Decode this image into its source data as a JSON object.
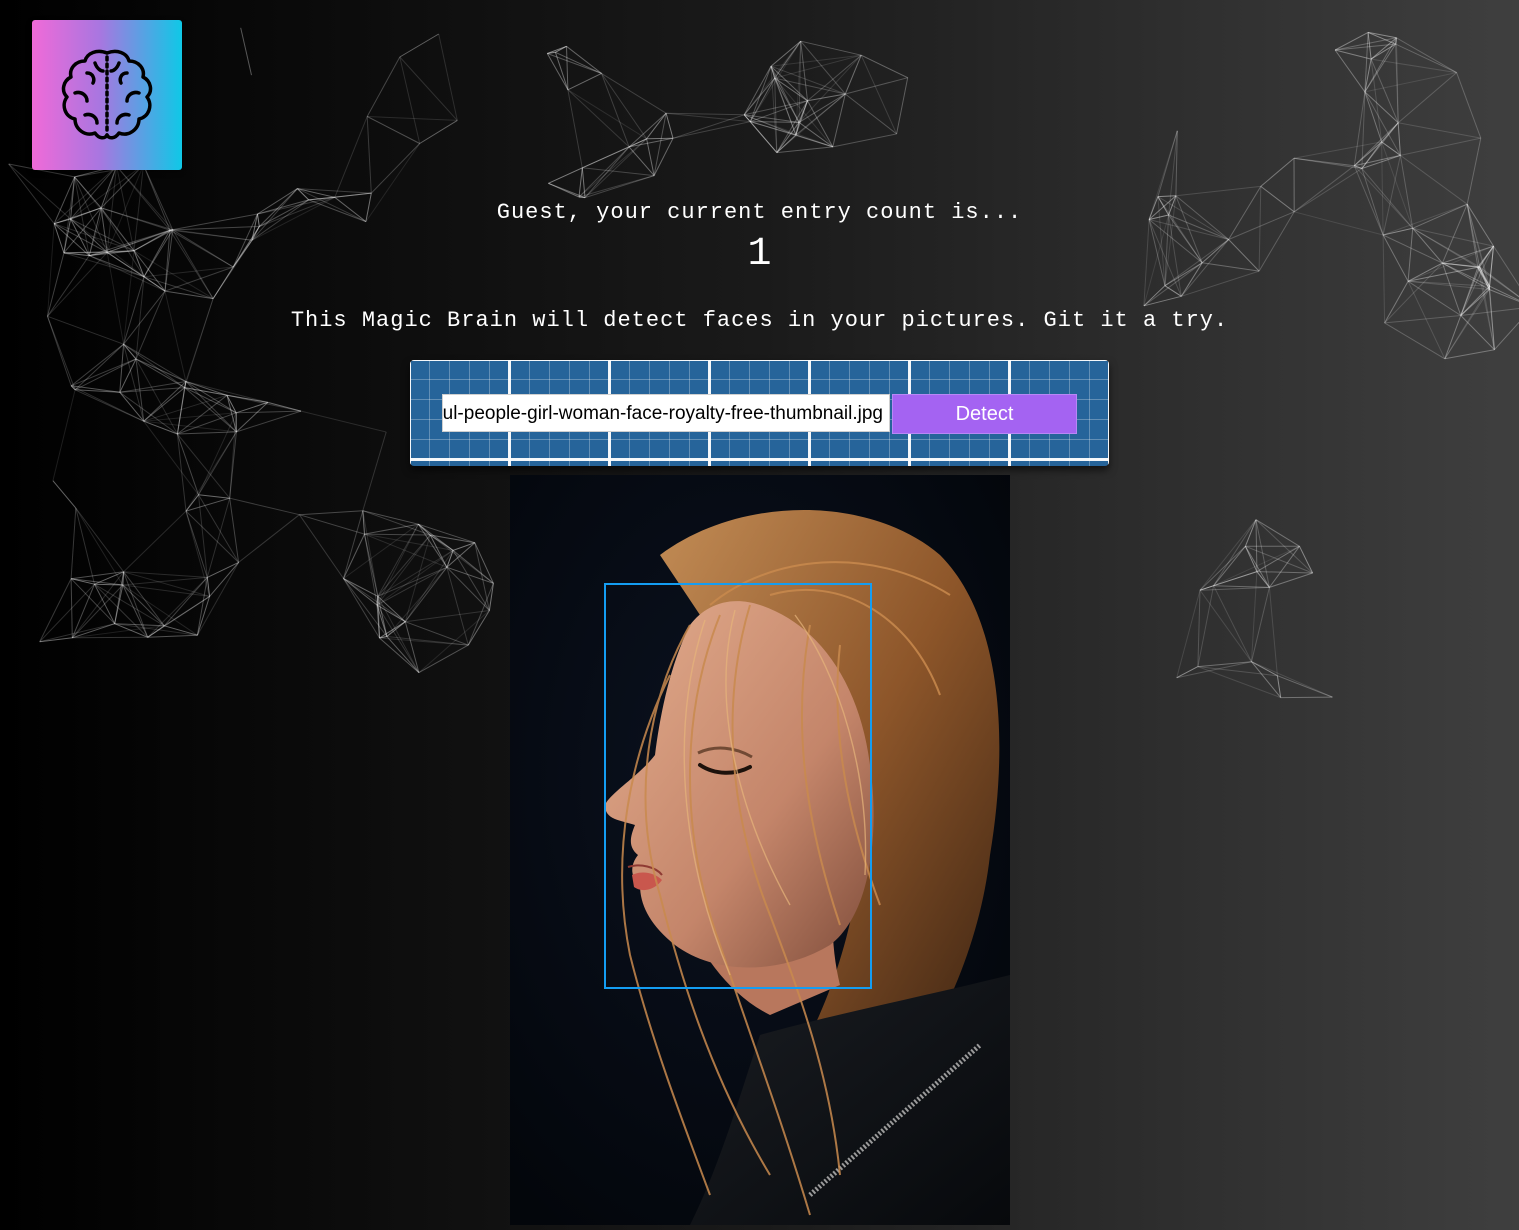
{
  "logo": {
    "icon": "brain-icon",
    "gradient": [
      "#f06ad8",
      "#0fc8e6"
    ]
  },
  "greeting": {
    "text": "Guest, your current entry count is..."
  },
  "entries": {
    "count": "1"
  },
  "tagline": {
    "text": "This Magic Brain will detect faces in your pictures. Git it a try."
  },
  "form": {
    "url_value": "beautiful-people-girl-woman-face-royalty-free-thumbnail.jpg",
    "detect_label": "Detect",
    "button_color": "#a463f2",
    "panel_color": "#26649a"
  },
  "result": {
    "box_color": "#149df2",
    "image_icon": "portrait-photo"
  }
}
